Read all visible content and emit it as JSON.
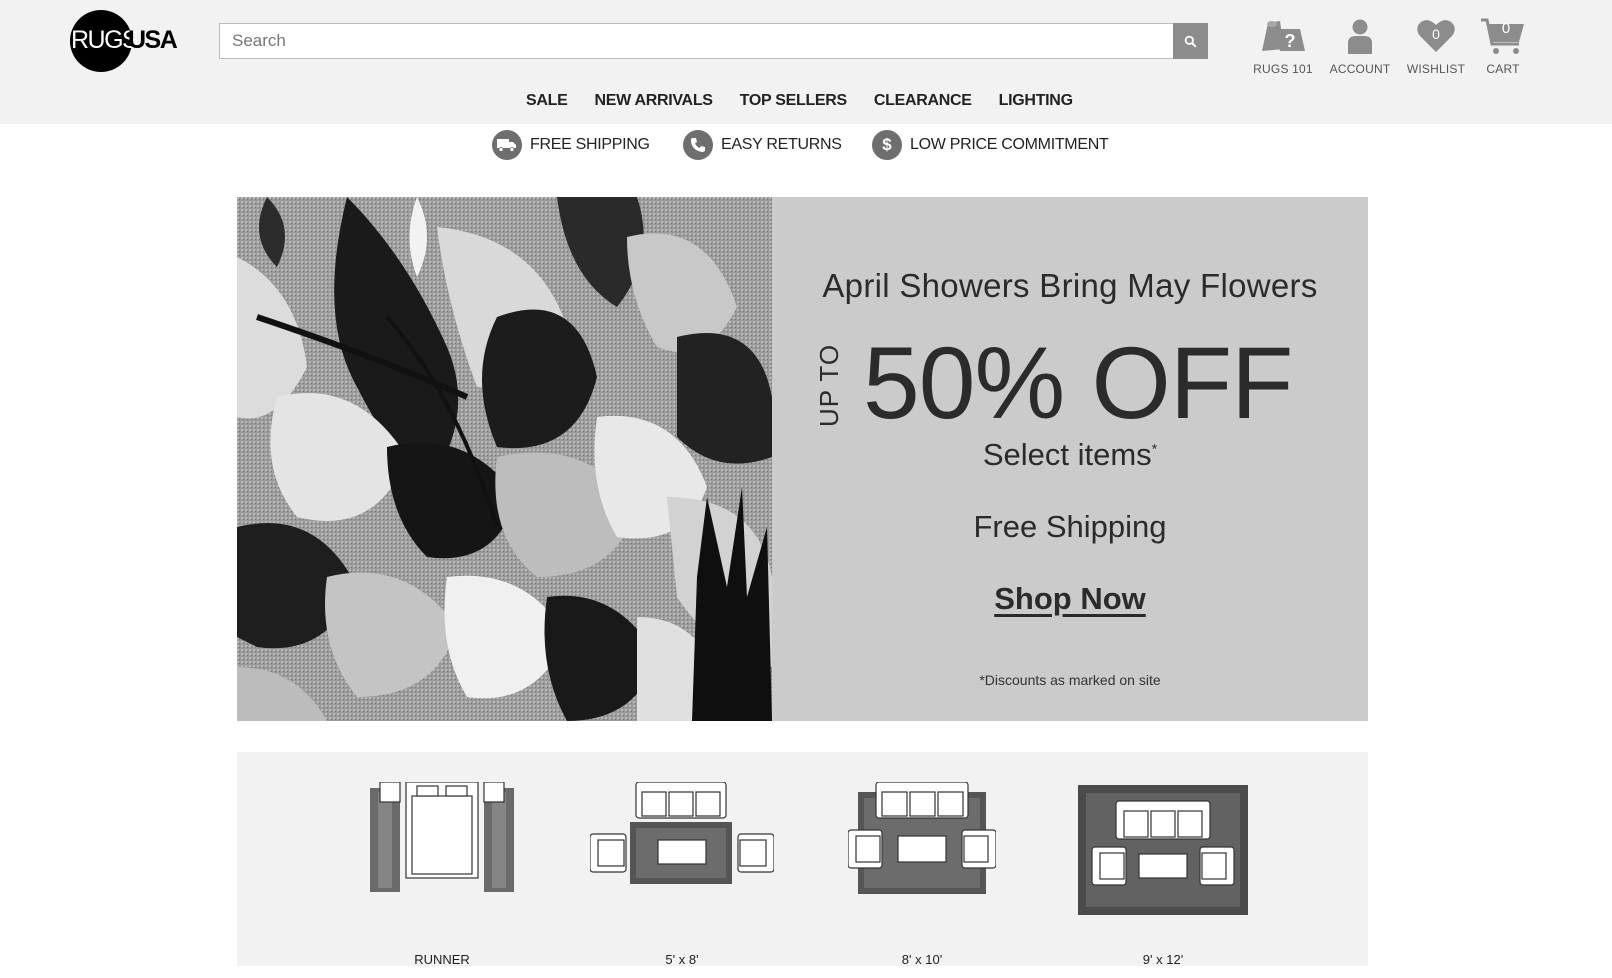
{
  "brand": {
    "logo_text_left": "RUGS",
    "logo_text_right": "USA"
  },
  "search": {
    "placeholder": "Search",
    "value": ""
  },
  "utility": {
    "rugs101": {
      "label": "RUGS 101",
      "icon": "question-rug-icon"
    },
    "account": {
      "label": "ACCOUNT",
      "icon": "person-icon"
    },
    "wishlist": {
      "label": "WISHLIST",
      "count": "0",
      "icon": "heart-icon"
    },
    "cart": {
      "label": "CART",
      "count": "0",
      "icon": "cart-icon"
    }
  },
  "nav": {
    "items": [
      {
        "label": "SALE"
      },
      {
        "label": "NEW ARRIVALS"
      },
      {
        "label": "TOP SELLERS"
      },
      {
        "label": "CLEARANCE"
      },
      {
        "label": "LIGHTING"
      }
    ]
  },
  "value_props": {
    "shipping": {
      "label": "FREE SHIPPING",
      "icon": "truck-icon"
    },
    "returns": {
      "label": "EASY RETURNS",
      "icon": "phone-icon"
    },
    "price": {
      "label": "LOW PRICE COMMITMENT",
      "icon": "dollar-icon"
    }
  },
  "hero": {
    "tagline": "April Showers Bring May Flowers",
    "up_to": "UP TO",
    "headline": "50% OFF",
    "select": "Select items",
    "select_mark": "*",
    "shipping": "Free Shipping",
    "cta": "Shop Now",
    "footnote": "*Discounts as marked on site"
  },
  "sizes": {
    "items": [
      {
        "label": "RUNNER"
      },
      {
        "label": "5' x 8'"
      },
      {
        "label": "8' x 10'"
      },
      {
        "label": "9' x 12'"
      }
    ]
  },
  "colors": {
    "header_bg": "#f2f2f2",
    "hero_bg": "#cbcbcb",
    "icon_gray": "#8c8c8c",
    "text": "#222222"
  }
}
